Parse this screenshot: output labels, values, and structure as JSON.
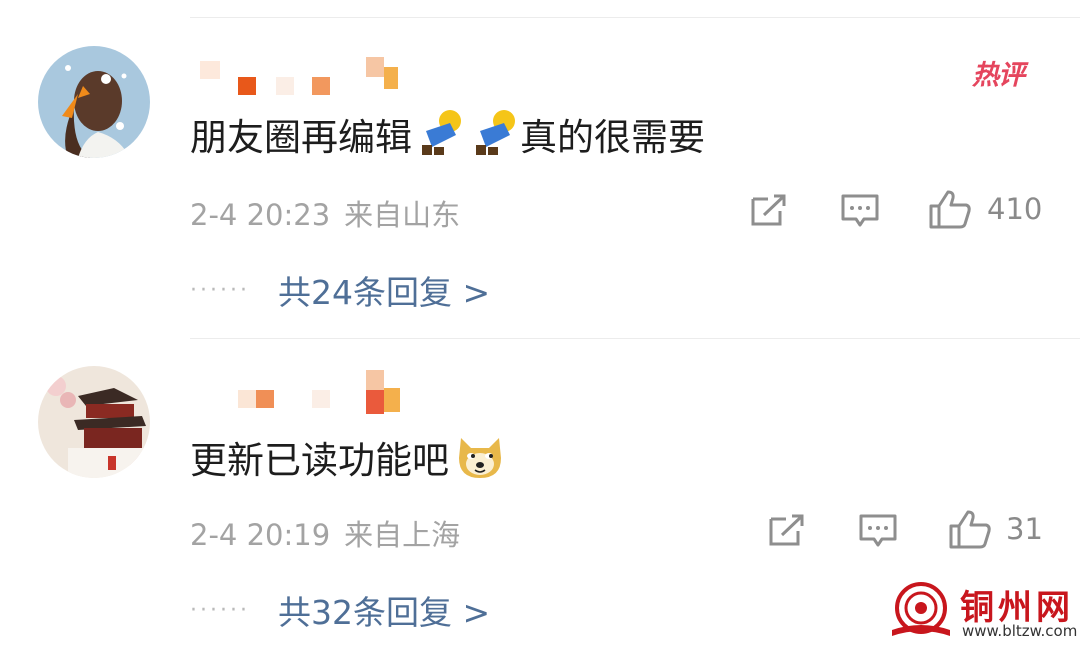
{
  "comments": [
    {
      "text": "朋友圈再编辑",
      "text_after": "真的很需要",
      "time": "2-4 20:23",
      "location": "来自山东",
      "likes": "410",
      "replies_label": "共24条回复 >",
      "badge": "热评",
      "emoji_name": "high-five-emoji"
    },
    {
      "text": "更新已读功能吧",
      "time": "2-4 20:19",
      "location": "来自上海",
      "likes": "31",
      "replies_label": "共32条回复 >",
      "emoji_name": "doge-emoji"
    }
  ],
  "dots": "······",
  "watermark": {
    "name": "铜州网",
    "url": "www.bltzw.com"
  },
  "colors": {
    "link": "#4f6f97",
    "meta": "#a3a3a3",
    "hot": "#e5455d",
    "watermark": "#c8161d"
  }
}
